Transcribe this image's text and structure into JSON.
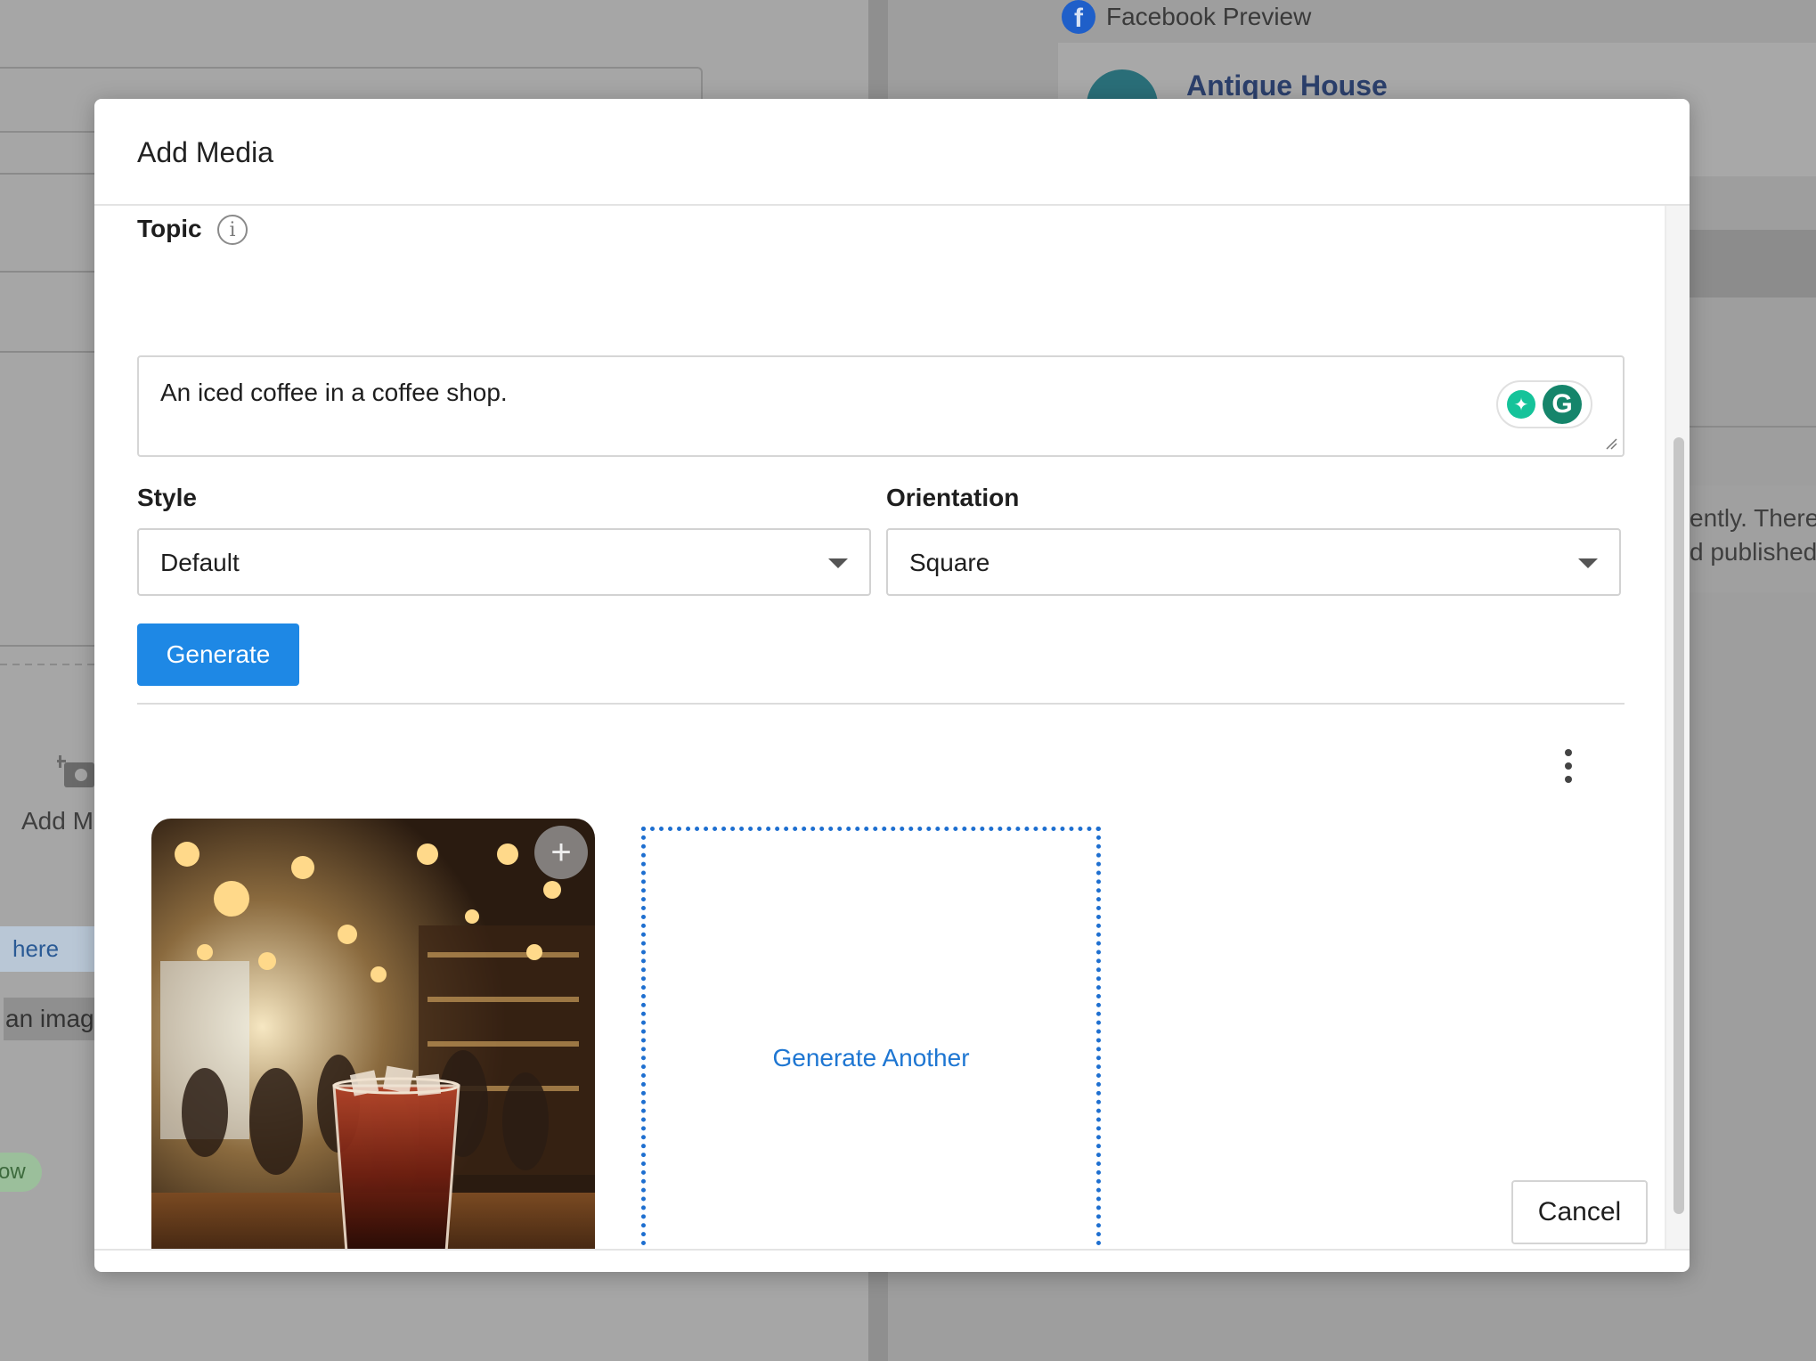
{
  "background": {
    "facebook_preview_title": "Facebook Preview",
    "page_name": "Antique House",
    "right_text_line1": "ently. There",
    "right_text_line2": "d published",
    "add_media_label": "Add M",
    "link_fragment": "here",
    "image_fragment": "an image",
    "badge_fragment": "ow"
  },
  "modal": {
    "title": "Add Media",
    "topic_label": "Topic",
    "topic_value": "An iced coffee in a coffee shop.",
    "style_label": "Style",
    "style_value": "Default",
    "orientation_label": "Orientation",
    "orientation_value": "Square",
    "generate_label": "Generate",
    "generate_another_label": "Generate Another",
    "cancel_label": "Cancel"
  },
  "colors": {
    "primary": "#1e88e5",
    "link": "#1e76d2",
    "grammarly": "#15856b"
  },
  "icons": [
    "facebook-icon",
    "info-icon",
    "grammarly-bulb-icon",
    "grammarly-g-icon",
    "chevron-down-icon",
    "kebab-menu-icon",
    "plus-icon",
    "camera-plus-icon"
  ]
}
